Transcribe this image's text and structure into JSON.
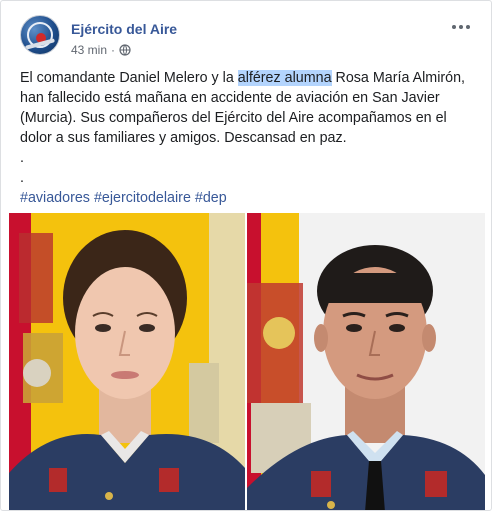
{
  "post": {
    "page_name": "Ejército del Aire",
    "timestamp": "43 min",
    "separator": "·",
    "icons": {
      "privacy": "globe-icon",
      "menu": "more-options-icon",
      "avatar": "page-avatar"
    },
    "text": {
      "line1_pre": "El comandante Daniel Melero y la ",
      "line1_highlight": "alférez alumna",
      "line1_post": " Rosa María Almirón,",
      "line2": "han fallecido está mañana en accidente de aviación en San Javier",
      "line3": "(Murcia). Sus compañeros del Ejército del Aire acompañamos en el",
      "line4": "dolor a sus familiares y amigos. Descansad en paz.",
      "line5": ".",
      "line6": "."
    },
    "hashtags": [
      "#aviadores",
      "#ejercitodelaire",
      "#dep"
    ],
    "photos": [
      {
        "subject": "portrait-young-woman-uniform"
      },
      {
        "subject": "portrait-man-uniform"
      }
    ]
  },
  "colors": {
    "link": "#385898",
    "text": "#1c1e21",
    "meta": "#616770",
    "highlight": "#b3d4fd",
    "flag_red": "#c8102e",
    "flag_yellow": "#f4c20d",
    "uniform": "#2b3d63"
  }
}
